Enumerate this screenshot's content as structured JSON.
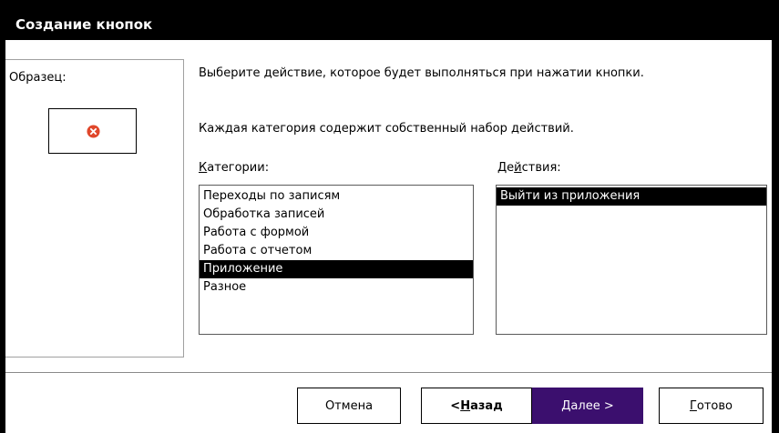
{
  "window": {
    "title": "Создание кнопок"
  },
  "sample": {
    "label": "Образец:",
    "icon": "close-circle-icon",
    "icon_color": "#e0472b"
  },
  "instructions": {
    "line1": "Выберите действие, которое будет выполняться при нажатии кнопки.",
    "line2": "Каждая категория содержит собственный набор действий."
  },
  "categories": {
    "label_prefix": "",
    "label_accel": "К",
    "label_rest": "атегории:",
    "items": [
      {
        "label": "Переходы по записям",
        "selected": false
      },
      {
        "label": "Обработка записей",
        "selected": false
      },
      {
        "label": "Работа с формой",
        "selected": false
      },
      {
        "label": "Работа с отчетом",
        "selected": false
      },
      {
        "label": "Приложение",
        "selected": true
      },
      {
        "label": "Разное",
        "selected": false
      }
    ]
  },
  "actions": {
    "label_prefix": "Де",
    "label_accel": "й",
    "label_rest": "ствия:",
    "items": [
      {
        "label": "Выйти из приложения",
        "selected": true
      }
    ]
  },
  "buttons": {
    "cancel": "Отмена",
    "back_prefix": "< ",
    "back_accel": "Н",
    "back_rest": "азад",
    "next_accel": "Д",
    "next_rest": "алее >",
    "finish_accel": "Г",
    "finish_rest": "отово"
  },
  "colors": {
    "accent": "#3b0f6e",
    "selection": "#000000",
    "titlebar": "#000000"
  }
}
